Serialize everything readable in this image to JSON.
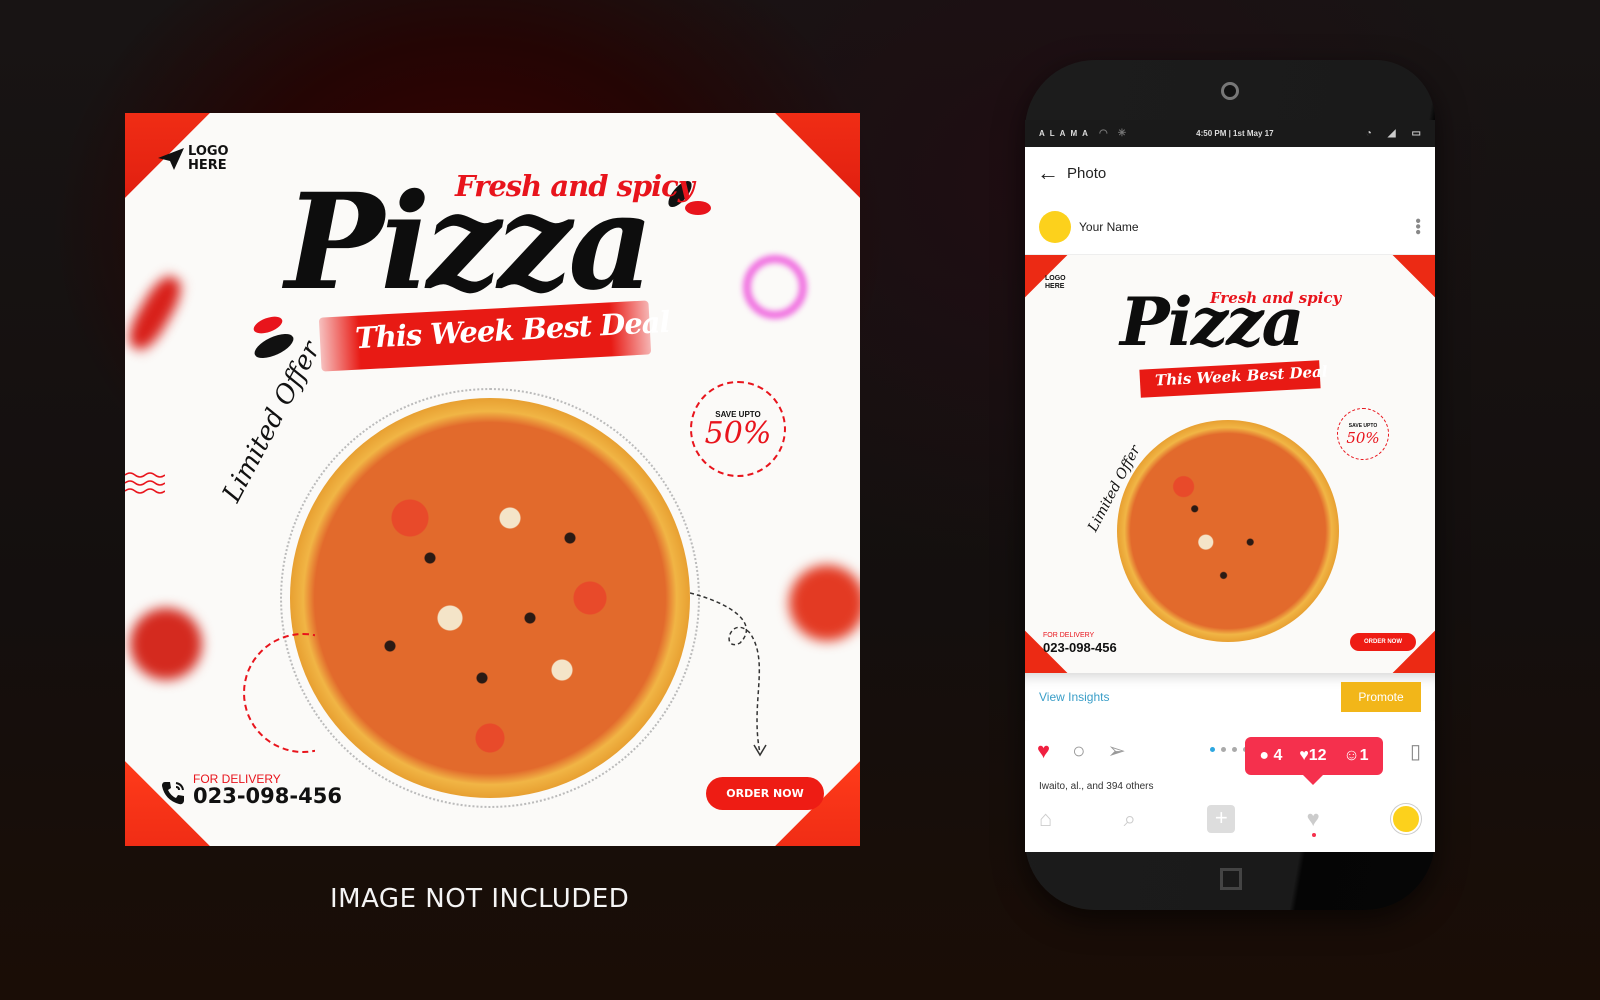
{
  "poster": {
    "logo_line1": "LOGO",
    "logo_line2": "HERE",
    "tagline": "Fresh and spicy",
    "title": "Pizza",
    "deal": "This Week Best Deal",
    "limited": "Limited Offer",
    "save_label": "SAVE UPTO",
    "save_value": "50%",
    "delivery_label": "FOR DELIVERY",
    "phone_number": "023-098-456",
    "order_button": "ORDER NOW"
  },
  "caption": "IMAGE NOT INCLUDED",
  "phone": {
    "statusbar": {
      "carrier": "ALAMA",
      "time": "4:50 PM | 1st May 17",
      "icons": [
        "wifi-icon",
        "bluetooth-icon",
        "alarm-icon",
        "signal-icon",
        "battery-icon"
      ]
    },
    "header": {
      "back_icon": "arrow-left-icon",
      "title": "Photo"
    },
    "user": {
      "name": "Your Name",
      "menu_icon": "kebab-menu-icon"
    },
    "insights": {
      "view_insights": "View Insights",
      "promote": "Promote"
    },
    "actions": {
      "icons": [
        "heart-icon",
        "comment-icon",
        "send-icon",
        "bookmark-icon"
      ],
      "page_count": 4,
      "active_page": 1
    },
    "notification": {
      "comments": "4",
      "likes": "12",
      "followers": "1"
    },
    "likes_line": "Iwaito, al., and 394 others",
    "tabbar": [
      "home-icon",
      "search-icon",
      "add-icon",
      "activity-heart-icon",
      "profile-avatar"
    ]
  },
  "colors": {
    "brand_red": "#e8141c",
    "notification_red": "#f5304d",
    "promote_yellow": "#f2b619",
    "link_blue": "#3a9ec8",
    "avatar_yellow": "#fcd11c"
  }
}
